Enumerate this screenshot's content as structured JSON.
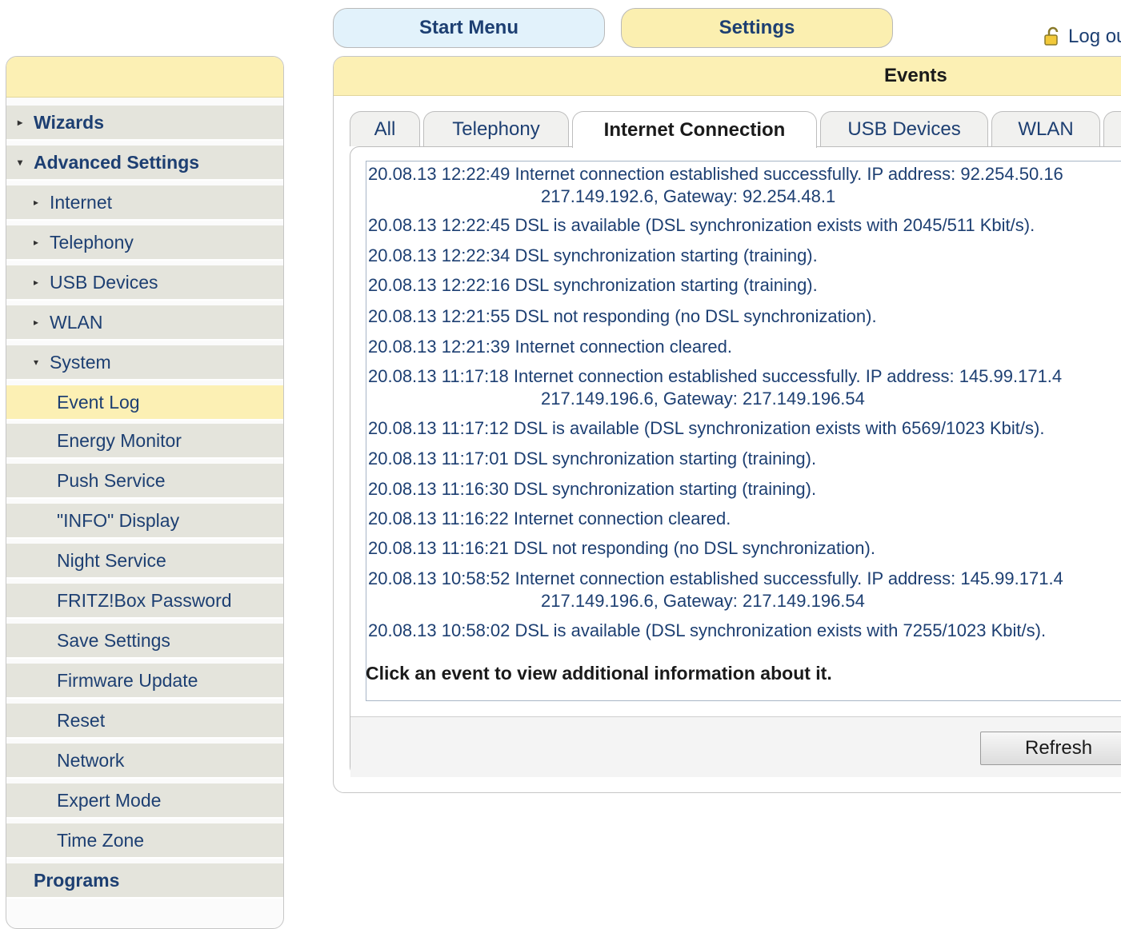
{
  "top_nav": {
    "start_menu": "Start Menu",
    "settings": "Settings",
    "logout": "Log out"
  },
  "sidebar": {
    "items": [
      {
        "label": "Wizards",
        "arrow": "▸"
      },
      {
        "label": "Advanced Settings",
        "arrow": "▾"
      },
      {
        "label": "Internet",
        "arrow": "▸"
      },
      {
        "label": "Telephony",
        "arrow": "▸"
      },
      {
        "label": "USB Devices",
        "arrow": "▸"
      },
      {
        "label": "WLAN",
        "arrow": "▸"
      },
      {
        "label": "System",
        "arrow": "▾"
      },
      {
        "label": "Event Log"
      },
      {
        "label": "Energy Monitor"
      },
      {
        "label": "Push Service"
      },
      {
        "label": "\"INFO\" Display"
      },
      {
        "label": "Night Service"
      },
      {
        "label": "FRITZ!Box Password"
      },
      {
        "label": "Save Settings"
      },
      {
        "label": "Firmware Update"
      },
      {
        "label": "Reset"
      },
      {
        "label": "Network"
      },
      {
        "label": "Expert Mode"
      },
      {
        "label": "Time Zone"
      },
      {
        "label": "Programs"
      }
    ]
  },
  "main": {
    "title": "Events",
    "tabs": [
      "All",
      "Telephony",
      "Internet Connection",
      "USB Devices",
      "WLAN"
    ],
    "active_tab": "Internet Connection",
    "events": [
      {
        "text": "20.08.13 12:22:49 Internet connection established successfully. IP address: 92.254.50.16",
        "cont": "217.149.192.6, Gateway: 92.254.48.1"
      },
      {
        "text": "20.08.13 12:22:45 DSL is available (DSL synchronization exists with 2045/511 Kbit/s)."
      },
      {
        "text": "20.08.13 12:22:34 DSL synchronization starting (training)."
      },
      {
        "text": "20.08.13 12:22:16 DSL synchronization starting (training)."
      },
      {
        "text": "20.08.13 12:21:55 DSL not responding (no DSL synchronization)."
      },
      {
        "text": "20.08.13 12:21:39 Internet connection cleared."
      },
      {
        "text": "20.08.13 11:17:18 Internet connection established successfully. IP address: 145.99.171.4",
        "cont": "217.149.196.6, Gateway: 217.149.196.54"
      },
      {
        "text": "20.08.13 11:17:12 DSL is available (DSL synchronization exists with 6569/1023 Kbit/s)."
      },
      {
        "text": "20.08.13 11:17:01 DSL synchronization starting (training)."
      },
      {
        "text": "20.08.13 11:16:30 DSL synchronization starting (training)."
      },
      {
        "text": "20.08.13 11:16:22 Internet connection cleared."
      },
      {
        "text": "20.08.13 11:16:21 DSL not responding (no DSL synchronization)."
      },
      {
        "text": "20.08.13 10:58:52 Internet connection established successfully. IP address: 145.99.171.4",
        "cont": "217.149.196.6, Gateway: 217.149.196.54"
      },
      {
        "text": "20.08.13 10:58:02 DSL is available (DSL synchronization exists with 7255/1023 Kbit/s)."
      }
    ],
    "hint": "Click an event to view additional information about it.",
    "refresh_label": "Refresh"
  }
}
